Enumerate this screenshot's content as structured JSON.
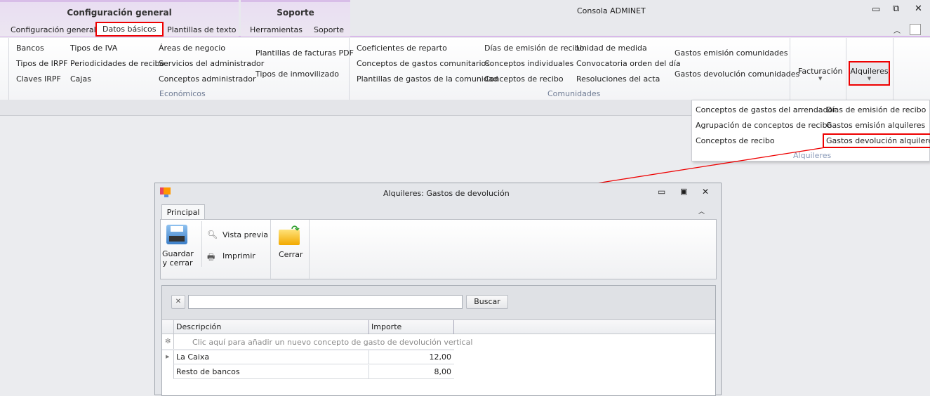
{
  "window": {
    "title": "Consola ADMINET"
  },
  "context_groups": [
    {
      "label": "Configuración general"
    },
    {
      "label": "Soporte"
    }
  ],
  "tabs": [
    {
      "label": "Configuración general"
    },
    {
      "label": "Datos básicos",
      "active": true
    },
    {
      "label": "Plantillas de texto"
    },
    {
      "label": "Herramientas"
    },
    {
      "label": "Soporte"
    }
  ],
  "ribbon": {
    "economicos": {
      "label": "Económicos",
      "col1": [
        "Bancos",
        "Tipos de IRPF",
        "Claves IRPF"
      ],
      "col2": [
        "Tipos de IVA",
        "Periodicidades de recibo",
        "Cajas"
      ],
      "col3": [
        "Áreas de negocio",
        "Servicios del administrador",
        "Conceptos administrador"
      ],
      "col4": [
        "Plantillas de facturas PDF",
        "Tipos de inmovilizado"
      ]
    },
    "comunidades": {
      "label": "Comunidades",
      "col1": [
        "Coeficientes de reparto",
        "Conceptos de gastos comunitarios",
        "Plantillas de gastos de la comunidad"
      ],
      "col2": [
        "Días de emisión de recibo",
        "Conceptos individuales",
        "Conceptos de recibo"
      ],
      "col3": [
        "Unidad de medida",
        "Convocatoria orden del día",
        "Resoluciones del acta"
      ],
      "col4": [
        "Gastos emisión comunidades",
        "Gastos devolución comunidades"
      ]
    },
    "facturacion": "Facturación",
    "alquileres": "Alquileres"
  },
  "menu": {
    "label": "Alquileres",
    "col1": [
      "Conceptos de gastos del arrendador",
      "Agrupación de conceptos de recibo",
      "Conceptos de recibo"
    ],
    "col2": [
      "Días de emisión de recibo",
      "Gastos emisión alquileres",
      "Gastos devolución alquileres"
    ]
  },
  "dialog": {
    "title": "Alquileres: Gastos de devolución",
    "tab": "Principal",
    "save": "Guardar y cerrar",
    "preview": "Vista previa",
    "print": "Imprimir",
    "close": "Cerrar",
    "search": {
      "value": "",
      "button": "Buscar"
    },
    "grid": {
      "headers": [
        "Descripción",
        "Importe"
      ],
      "new_row_hint": "Clic aquí para añadir un nuevo concepto de gasto de devolución vertical",
      "rows": [
        {
          "descripcion": "La Caixa",
          "importe": "12,00"
        },
        {
          "descripcion": "Resto de bancos",
          "importe": "8,00"
        }
      ]
    }
  },
  "colors": {
    "highlight": "#e00000",
    "context": "#e9def2"
  }
}
